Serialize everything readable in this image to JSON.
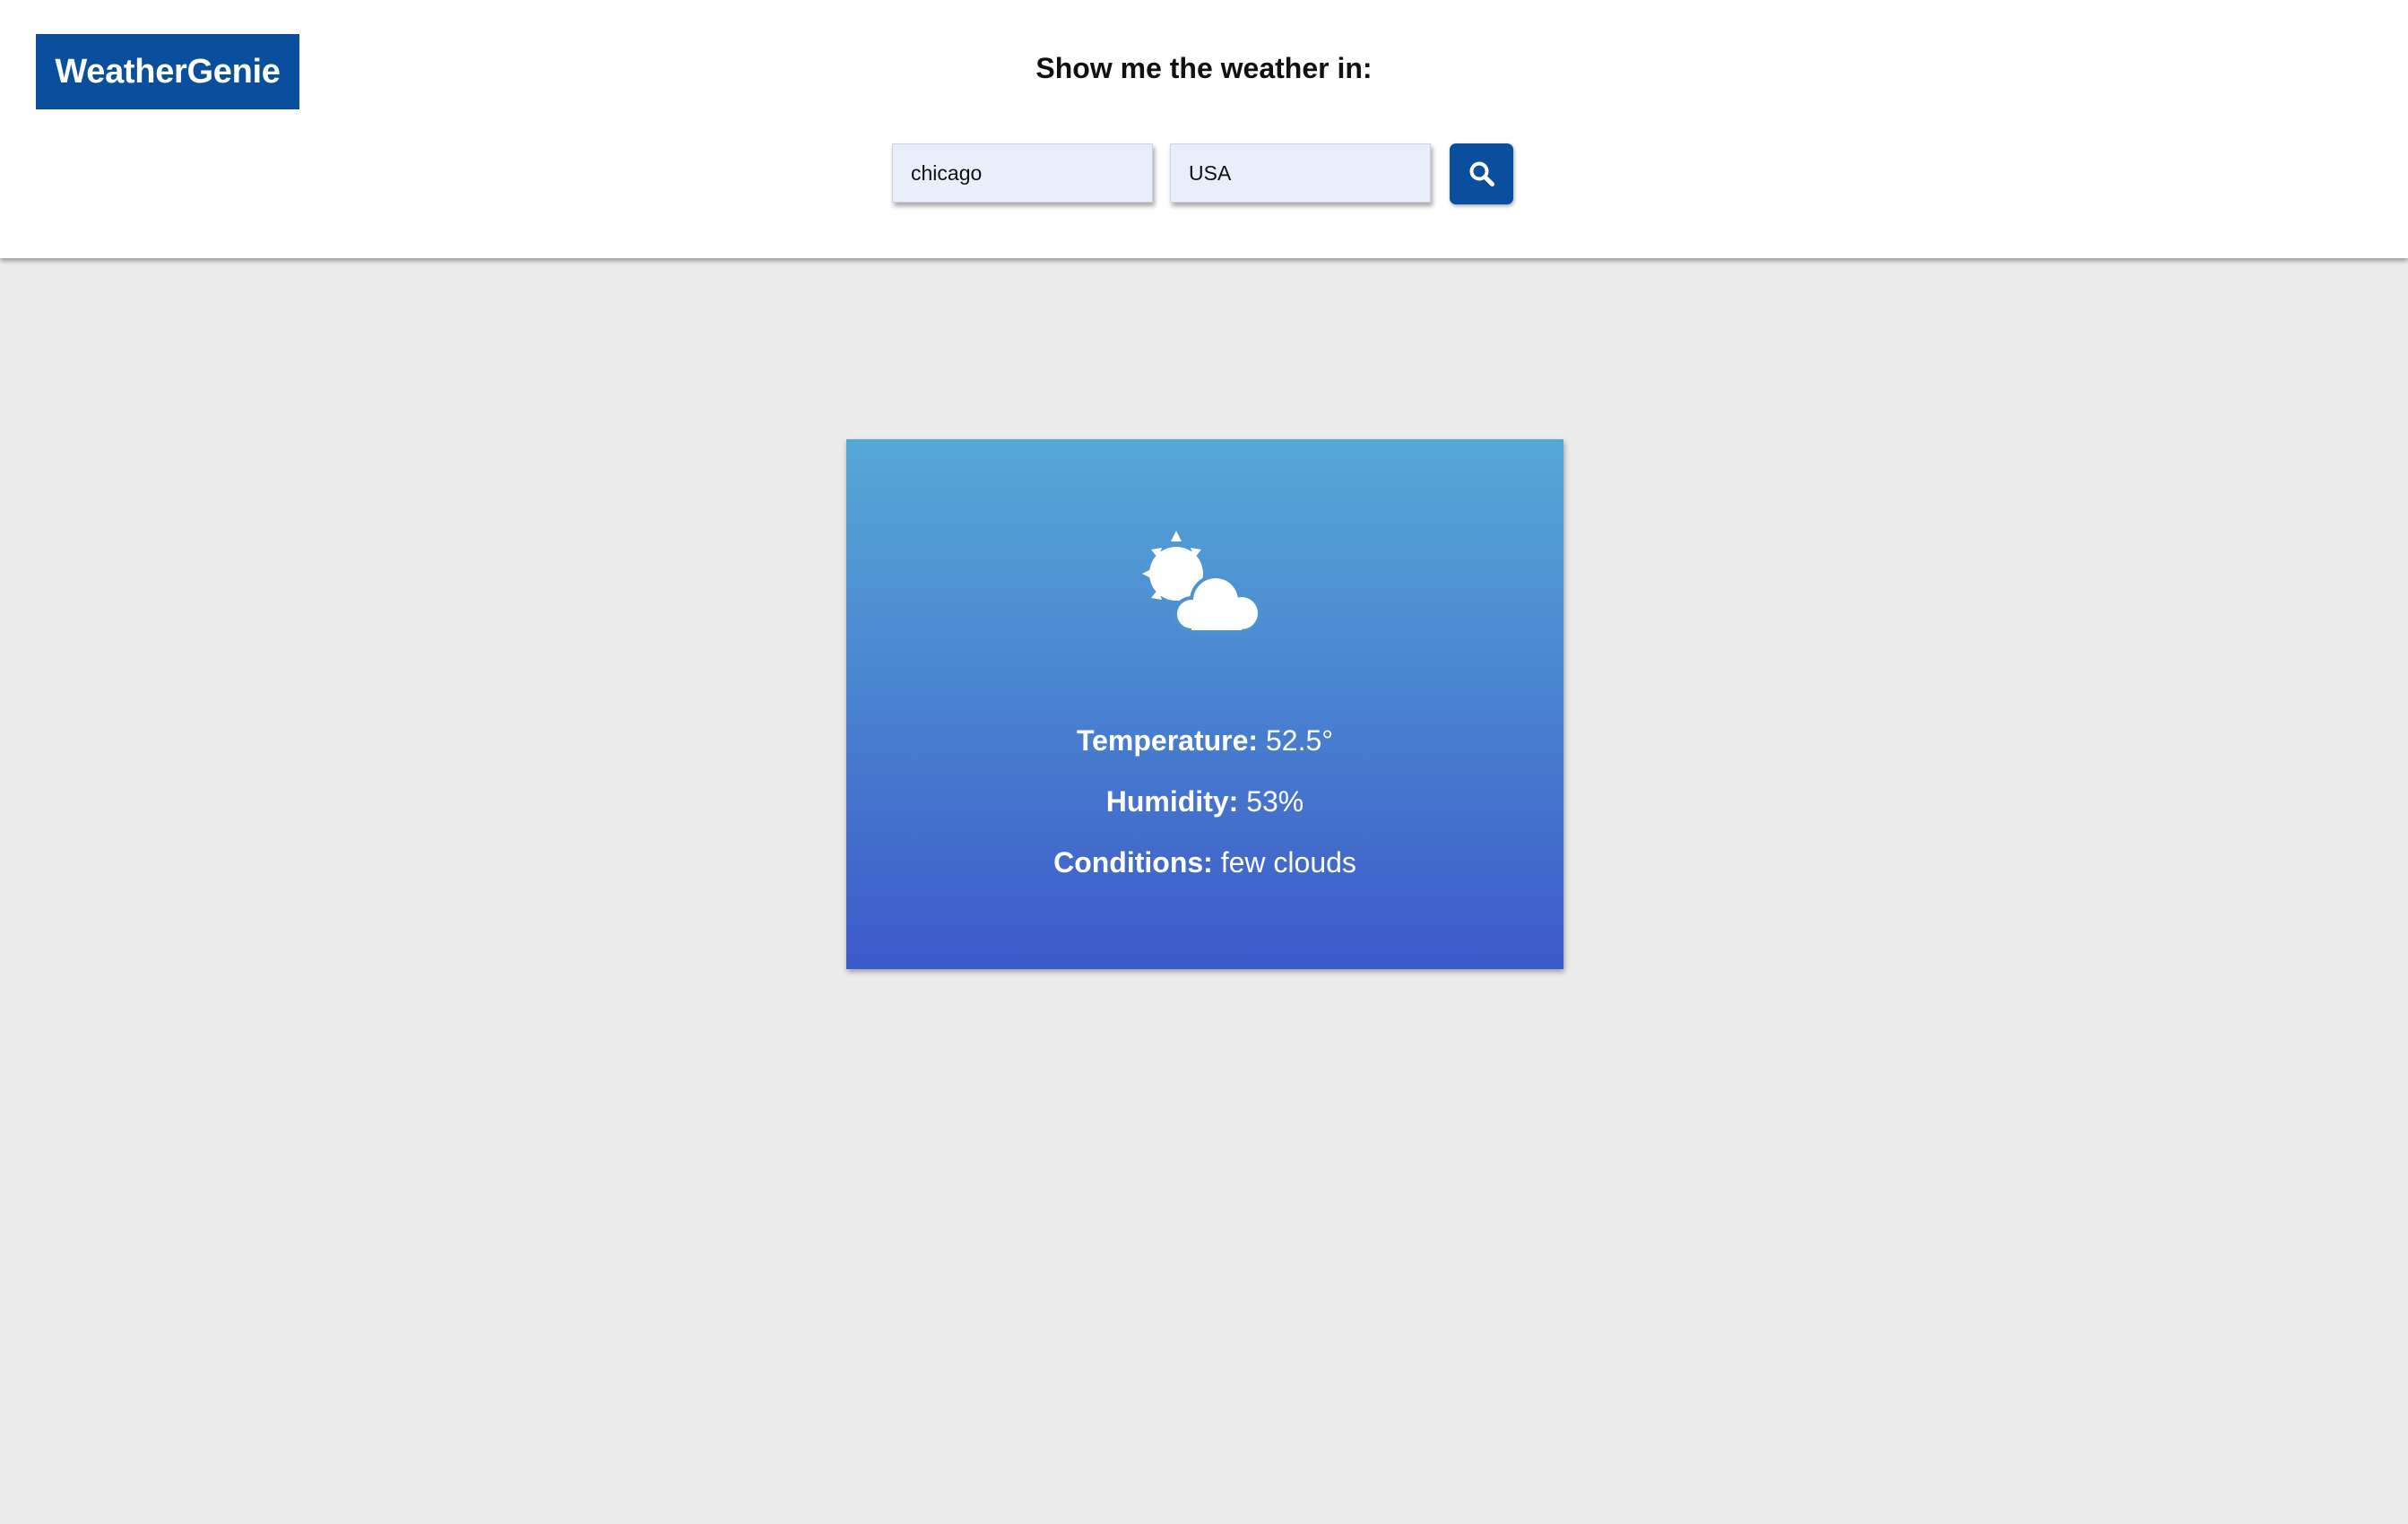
{
  "app": {
    "logo_text": "WeatherGenie",
    "brand_color": "#0a4e9e"
  },
  "search": {
    "prompt": "Show me the weather in:",
    "city_value": "chicago",
    "country_value": "USA",
    "button_icon": "search-icon"
  },
  "weather": {
    "icon": "partly-cloudy-icon",
    "temperature_label": "Temperature:",
    "temperature_value": "52.5°",
    "humidity_label": "Humidity:",
    "humidity_value": "53%",
    "conditions_label": "Conditions:",
    "conditions_value": "few clouds",
    "gradient_top": "#55a8d6",
    "gradient_bottom": "#3c59c9"
  },
  "colors": {
    "page_background": "#ececec",
    "header_background": "#ffffff",
    "input_background": "#e8eefa"
  }
}
